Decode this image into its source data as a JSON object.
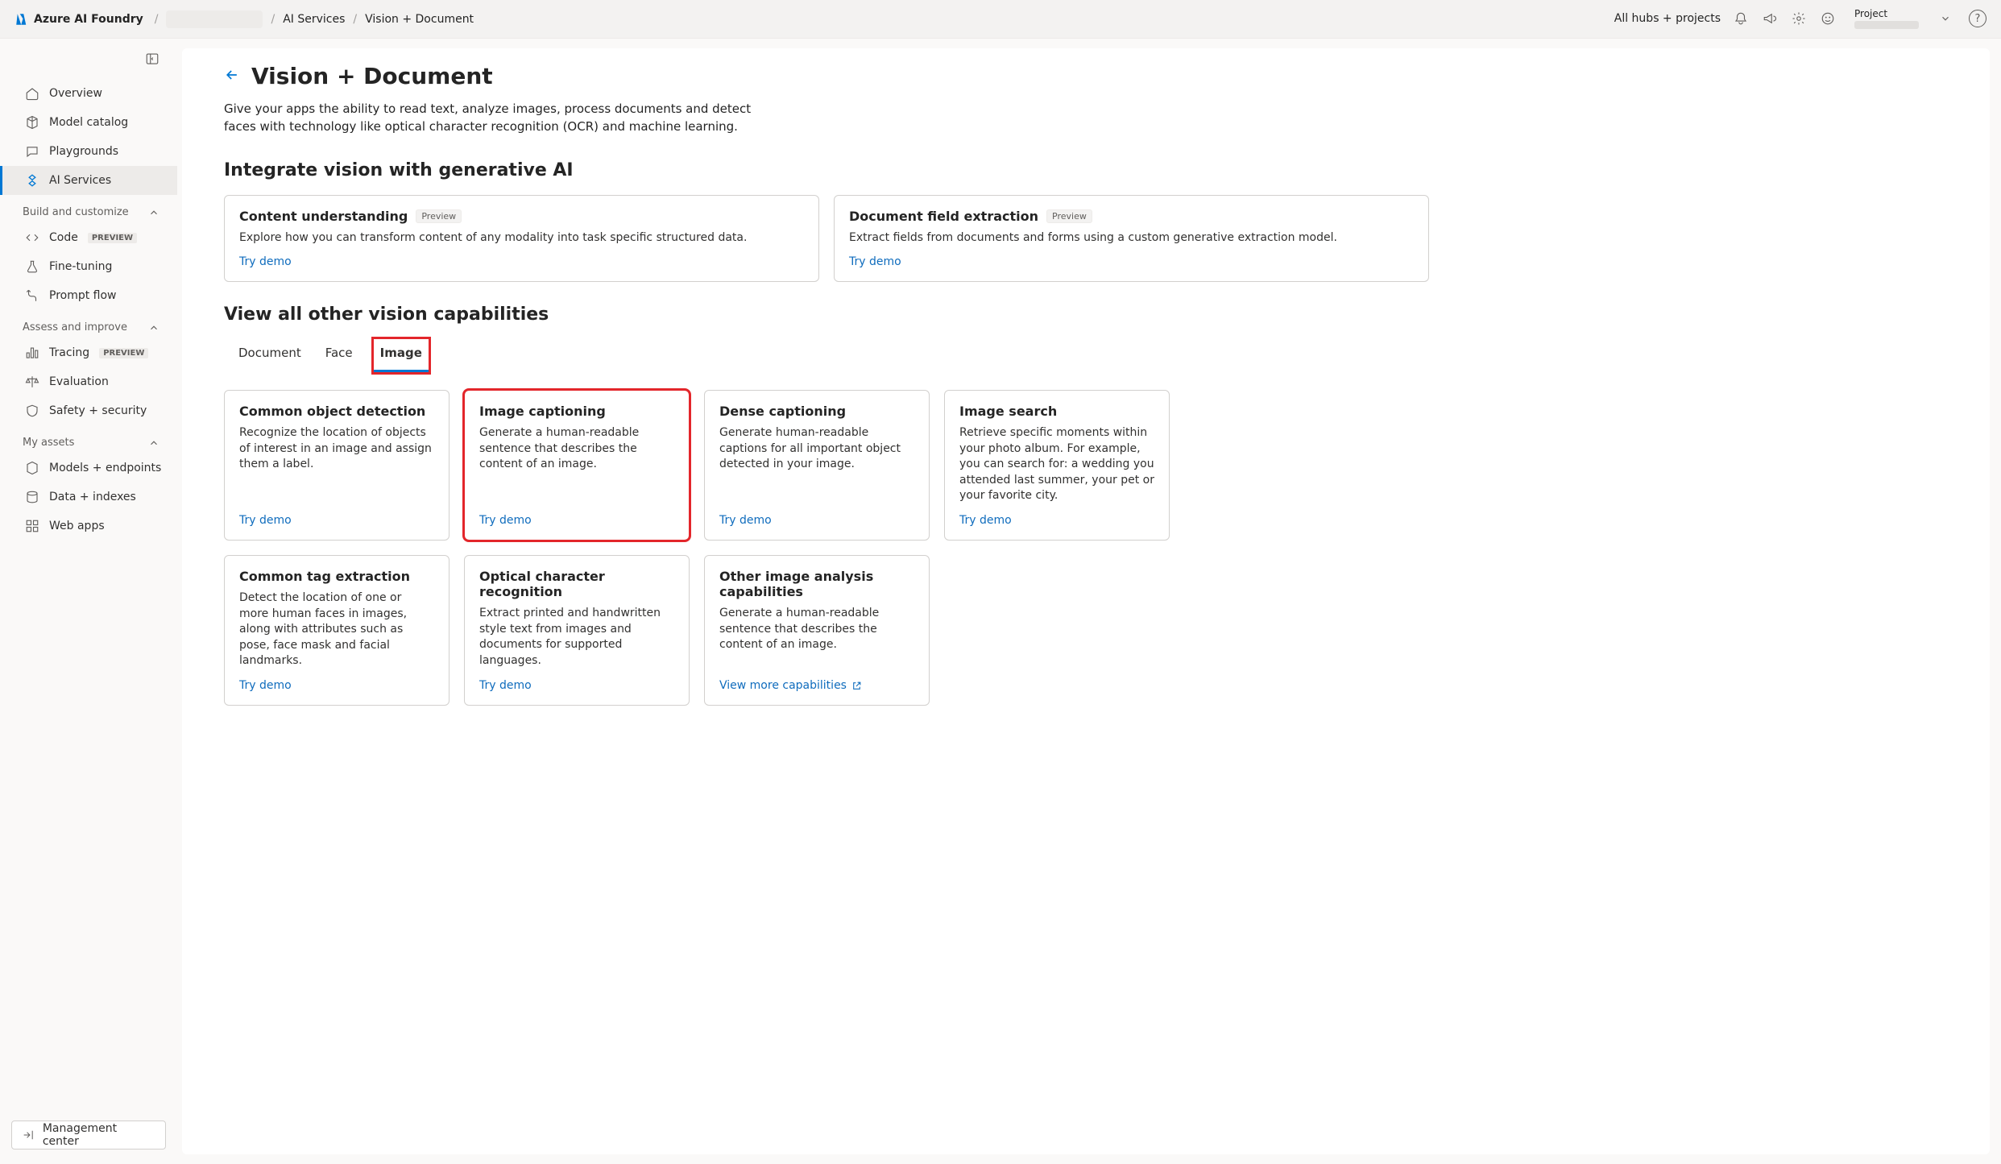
{
  "header": {
    "product": "Azure AI Foundry",
    "breadcrumb": [
      "AI Services",
      "Vision + Document"
    ],
    "hubs_label": "All hubs + projects",
    "project_label": "Project"
  },
  "sidebar": {
    "items_top": [
      {
        "label": "Overview"
      },
      {
        "label": "Model catalog"
      },
      {
        "label": "Playgrounds"
      },
      {
        "label": "AI Services"
      }
    ],
    "section_build": "Build and customize",
    "items_build": [
      {
        "label": "Code",
        "badge": "PREVIEW"
      },
      {
        "label": "Fine-tuning"
      },
      {
        "label": "Prompt flow"
      }
    ],
    "section_assess": "Assess and improve",
    "items_assess": [
      {
        "label": "Tracing",
        "badge": "PREVIEW"
      },
      {
        "label": "Evaluation"
      },
      {
        "label": "Safety + security"
      }
    ],
    "section_assets": "My assets",
    "items_assets": [
      {
        "label": "Models + endpoints"
      },
      {
        "label": "Data + indexes"
      },
      {
        "label": "Web apps"
      }
    ],
    "management": "Management center"
  },
  "page": {
    "title": "Vision + Document",
    "desc": "Give your apps the ability to read text, analyze images, process documents and detect faces with technology like optical character recognition (OCR) and machine learning.",
    "section1": "Integrate vision with generative AI",
    "gen_cards": [
      {
        "title": "Content understanding",
        "badge": "Preview",
        "desc": "Explore how you can transform content of any modality into task specific structured data.",
        "link": "Try demo"
      },
      {
        "title": "Document field extraction",
        "badge": "Preview",
        "desc": "Extract fields from documents and forms using a custom generative extraction model.",
        "link": "Try demo"
      }
    ],
    "section2": "View all other vision capabilities",
    "tabs": [
      "Document",
      "Face",
      "Image"
    ],
    "active_tab": 2,
    "cap_row1": [
      {
        "title": "Common object detection",
        "desc": "Recognize the location of objects of interest in an image and assign them a label.",
        "link": "Try demo"
      },
      {
        "title": "Image captioning",
        "desc": "Generate a human-readable sentence that describes the content of an image.",
        "link": "Try demo",
        "highlight": true
      },
      {
        "title": "Dense captioning",
        "desc": "Generate human-readable captions for all important object detected in your image.",
        "link": "Try demo"
      },
      {
        "title": "Image search",
        "desc": "Retrieve specific moments within your photo album. For example, you can search for: a wedding you attended last summer, your pet or your favorite city.",
        "link": "Try demo"
      }
    ],
    "cap_row2": [
      {
        "title": "Common tag extraction",
        "desc": "Detect the location of one or more human faces in images, along with attributes such as pose, face mask and facial landmarks.",
        "link": "Try demo"
      },
      {
        "title": "Optical character recognition",
        "desc": "Extract printed and handwritten style text from images and documents for supported languages.",
        "link": "Try demo"
      },
      {
        "title": "Other image analysis capabilities",
        "desc": "Generate a human-readable sentence that describes the content of an image.",
        "link": "View more capabilities",
        "ext": true
      }
    ]
  }
}
